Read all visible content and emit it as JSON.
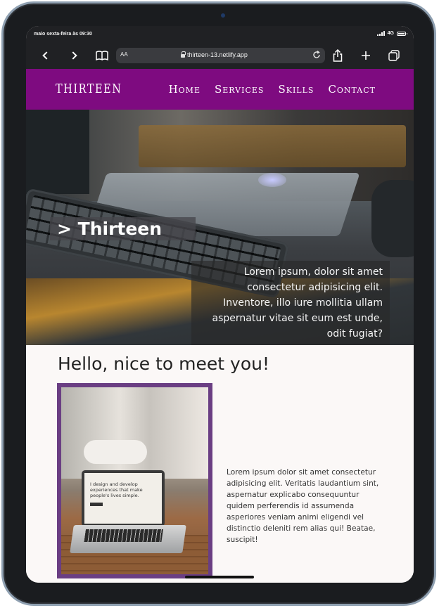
{
  "status_bar": {
    "time": "maio sexta-feira às 09:30",
    "network": "4G"
  },
  "browser": {
    "text_size_label": "AA",
    "url": "thirteen-13.netlify.app",
    "icons": [
      "back-chevron-icon",
      "forward-chevron-icon",
      "book-icon",
      "lock-icon",
      "reload-icon",
      "share-icon",
      "plus-icon",
      "tabs-icon"
    ]
  },
  "site": {
    "logo": "THIRTEEN",
    "nav": [
      "Home",
      "Services",
      "Skills",
      "Contact"
    ],
    "brand_color": "#7e0b80"
  },
  "hero": {
    "title": "> Thirteen",
    "text": "Lorem ipsum, dolor sit amet consectetur adipisicing elit. Inventore, illo iure mollitia ullam aspernatur vitae sit eum est unde, odit fugiat?"
  },
  "content": {
    "greeting": "Hello, nice to meet you!",
    "photo_screen_text": "I design and develop experiences that make people's lives simple.",
    "about": "Lorem ipsum dolor sit amet consectetur adipisicing elit. Veritatis laudantium sint, aspernatur explicabo consequuntur quidem perferendis id assumenda asperiores veniam animi eligendi vel distinctio deleniti rem alias qui! Beatae, suscipit!",
    "photo_border_color": "#6a3e83"
  }
}
